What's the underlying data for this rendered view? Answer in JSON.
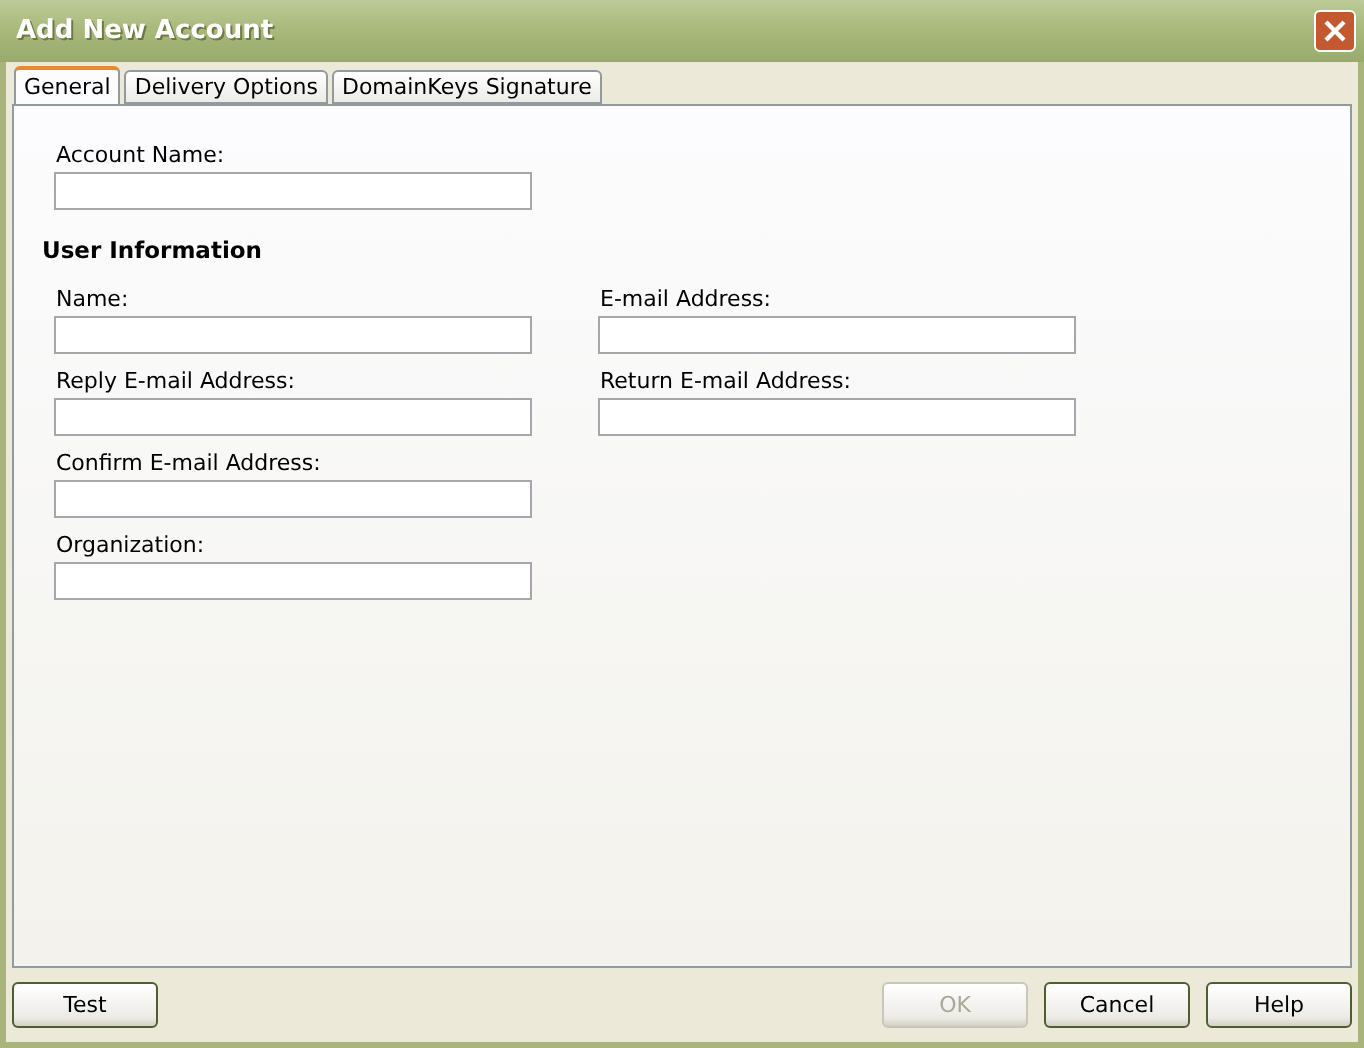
{
  "window": {
    "title": "Add New Account"
  },
  "tabs": [
    {
      "label": "General",
      "selected": true
    },
    {
      "label": "Delivery Options",
      "selected": false
    },
    {
      "label": "DomainKeys Signature",
      "selected": false
    }
  ],
  "account_name": {
    "label": "Account Name:"
  },
  "user_information": {
    "heading": "User Information",
    "left_fields": [
      {
        "label": "Name:"
      },
      {
        "label": "Reply E-mail Address:"
      },
      {
        "label": "Confirm E-mail Address:"
      },
      {
        "label": "Organization:"
      }
    ],
    "right_fields": [
      {
        "label": "E-mail Address:"
      },
      {
        "label": "Return E-mail Address:"
      }
    ]
  },
  "buttons": [
    {
      "label": "Test",
      "disabled": false
    },
    {
      "label": "OK",
      "disabled": true
    },
    {
      "label": "Cancel",
      "disabled": false
    },
    {
      "label": "Help",
      "disabled": false
    }
  ]
}
